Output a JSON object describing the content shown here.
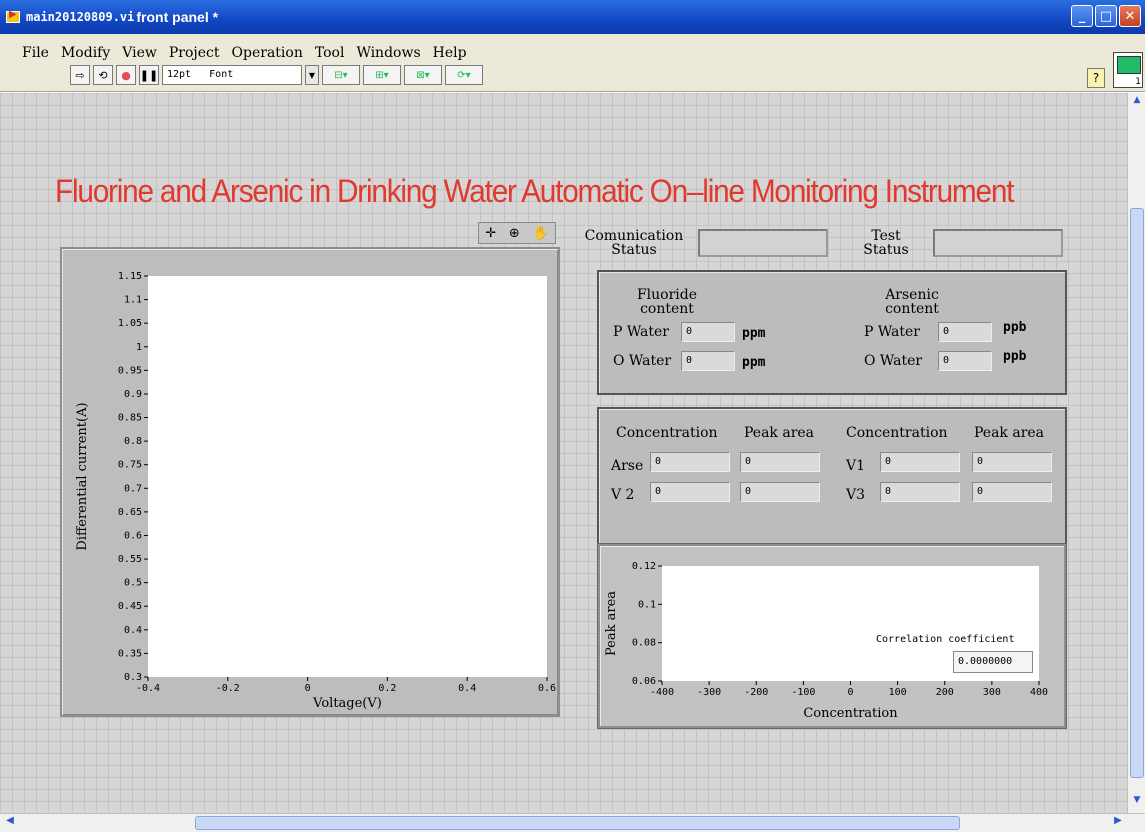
{
  "window": {
    "title_file": "main20120809.vi",
    "title_rest": "front panel *",
    "controls": [
      "minimize-icon",
      "maximize-icon",
      "close-icon"
    ]
  },
  "menu": [
    "File",
    "Modify",
    "View",
    "Project",
    "Operation",
    "Tool",
    "Windows",
    "Help"
  ],
  "toolbar": {
    "font_size": "12pt",
    "font_label": "Font"
  },
  "panel_title": "Fluorine and Arsenic in Drinking Water Automatic On–line Monitoring Instrument",
  "status": {
    "communication_label": "Comunication\nStatus",
    "test_label": "Test\nStatus",
    "communication_value": "",
    "test_value": ""
  },
  "fluoride": {
    "heading": "Fluoride\ncontent",
    "p_water_label": "P Water",
    "p_water_value": "0",
    "p_water_unit": "ppm",
    "o_water_label": "O Water",
    "o_water_value": "0",
    "o_water_unit": "ppm"
  },
  "arsenic": {
    "heading": "Arsenic\ncontent",
    "p_water_label": "P Water",
    "p_water_value": "0",
    "p_water_unit": "ppb",
    "o_water_label": "O Water",
    "o_water_value": "0",
    "o_water_unit": "ppb"
  },
  "measurements": {
    "headers": [
      "Concentration",
      "Peak area",
      "Concentration",
      "Peak area"
    ],
    "rows": [
      {
        "left_label": "Arse",
        "conc1": "0",
        "peak1": "0",
        "right_label": "V1",
        "conc2": "0",
        "peak2": "0"
      },
      {
        "left_label": "V 2",
        "conc1": "0",
        "peak1": "0",
        "right_label": "V3",
        "conc2": "0",
        "peak2": "0"
      }
    ]
  },
  "correlation": {
    "label": "Correlation coefficient",
    "value": "0.0000000"
  },
  "chart_data": [
    {
      "type": "line",
      "title": "",
      "xlabel": "Voltage(V)",
      "ylabel": "Differential current(A)",
      "xlim": [
        -0.4,
        0.6
      ],
      "ylim": [
        0.3,
        1.15
      ],
      "x_ticks": [
        "-0.4",
        "-0.2",
        "0",
        "0.2",
        "0.4",
        "0.6"
      ],
      "y_ticks": [
        "1.15",
        "1.1",
        "1.05",
        "1",
        "0.95",
        "0.9",
        "0.85",
        "0.8",
        "0.75",
        "0.7",
        "0.65",
        "0.6",
        "0.55",
        "0.5",
        "0.45",
        "0.4",
        "0.35",
        "0.3"
      ],
      "series": [],
      "grid": false
    },
    {
      "type": "scatter",
      "title": "",
      "xlabel": "Concentration",
      "ylabel": "Peak area",
      "xlim": [
        -400,
        400
      ],
      "ylim": [
        0.06,
        0.12
      ],
      "x_ticks": [
        "-400",
        "-300",
        "-200",
        "-100",
        "0",
        "100",
        "200",
        "300",
        "400"
      ],
      "y_ticks": [
        "0.12",
        "0.1",
        "0.08",
        "0.06"
      ],
      "series": [],
      "grid": false
    }
  ]
}
